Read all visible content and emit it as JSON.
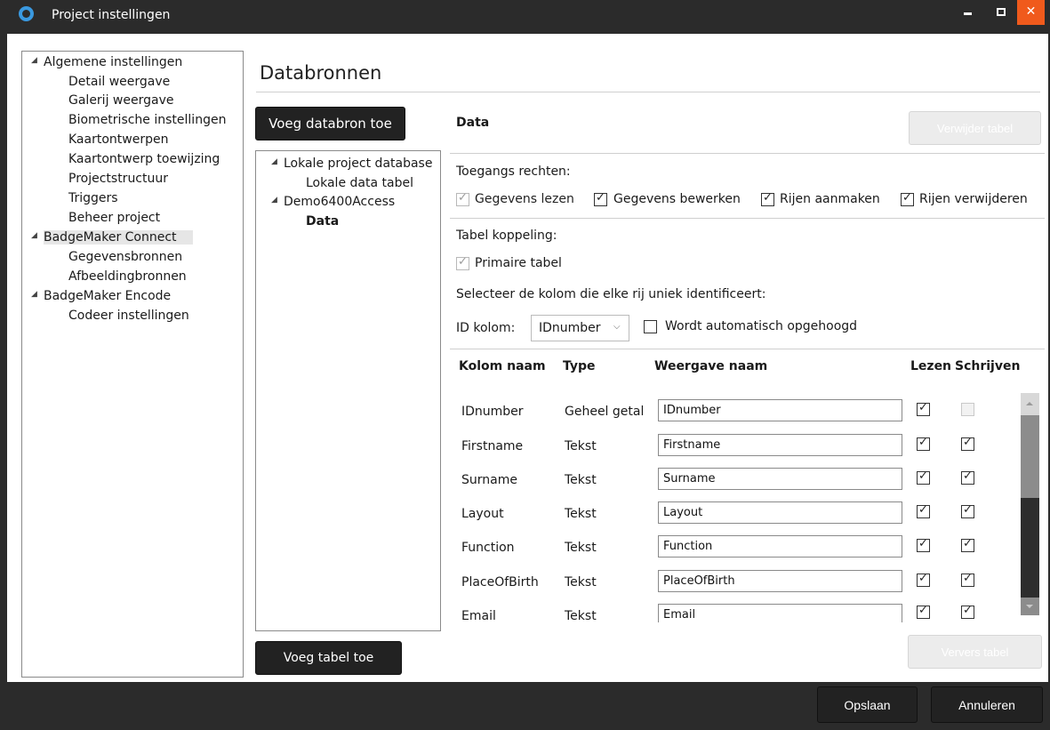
{
  "window": {
    "title": "Project instellingen",
    "close_glyph": "✕"
  },
  "nav_tree": {
    "groups": [
      {
        "label": "Algemene instellingen",
        "items": [
          "Detail weergave",
          "Galerij weergave",
          "Biometrische instellingen",
          "Kaartontwerpen",
          "Kaartontwerp toewijzing",
          "Projectstructuur",
          "Triggers",
          "Beheer project"
        ]
      },
      {
        "label": "BadgeMaker Connect",
        "selected": true,
        "items": [
          "Gegevensbronnen",
          "Afbeeldingbronnen"
        ]
      },
      {
        "label": "BadgeMaker Encode",
        "items": [
          "Codeer instellingen"
        ]
      }
    ]
  },
  "page": {
    "title": "Databronnen",
    "add_datasource_label": "Voeg databron toe",
    "add_table_label": "Voeg tabel toe"
  },
  "ds_tree": {
    "groups": [
      {
        "label": "Lokale project database",
        "items": [
          "Lokale data tabel"
        ]
      },
      {
        "label": "Demo6400Access",
        "items": [
          "Data"
        ]
      }
    ]
  },
  "table_panel": {
    "name": "Data",
    "delete_label": "Verwijder tabel",
    "refresh_label": "Ververs tabel",
    "rights_heading": "Toegangs rechten:",
    "rights": [
      {
        "label": "Gegevens lezen",
        "checked": true,
        "disabled": true
      },
      {
        "label": "Gegevens bewerken",
        "checked": true
      },
      {
        "label": "Rijen aanmaken",
        "checked": true
      },
      {
        "label": "Rijen verwijderen",
        "checked": true
      }
    ],
    "link_heading": "Tabel koppeling:",
    "primary_table_label": "Primaire tabel",
    "unique_id_text": "Selecteer de kolom die elke rij uniek identificeert:",
    "id_column_label": "ID kolom:",
    "id_column_value": "IDnumber",
    "auto_increment_label": "Wordt automatisch opgehoogd"
  },
  "columns_grid": {
    "headers": [
      "Kolom naam",
      "Type",
      "Weergave naam",
      "Lezen",
      "Schrijven"
    ],
    "rows": [
      {
        "name": "IDnumber",
        "type": "Geheel getal",
        "display": "IDnumber",
        "read": true,
        "write": false,
        "write_disabled": true
      },
      {
        "name": "Firstname",
        "type": "Tekst",
        "display": "Firstname",
        "read": true,
        "write": true
      },
      {
        "name": "Surname",
        "type": "Tekst",
        "display": "Surname",
        "read": true,
        "write": true
      },
      {
        "name": "Layout",
        "type": "Tekst",
        "display": "Layout",
        "read": true,
        "write": true
      },
      {
        "name": "Function",
        "type": "Tekst",
        "display": "Function",
        "read": true,
        "write": true
      },
      {
        "name": "PlaceOfBirth",
        "type": "Tekst",
        "display": "PlaceOfBirth",
        "read": true,
        "write": true
      },
      {
        "name": "Email",
        "type": "Tekst",
        "display": "Email",
        "read": true,
        "write": true
      }
    ]
  },
  "footer": {
    "save_label": "Opslaan",
    "cancel_label": "Annuleren"
  },
  "colors": {
    "titlebar_bg": "#2b2b2b",
    "close_button": "#f05a1c",
    "dark_button": "#222222",
    "selected_nav": "#e6e6e6"
  }
}
